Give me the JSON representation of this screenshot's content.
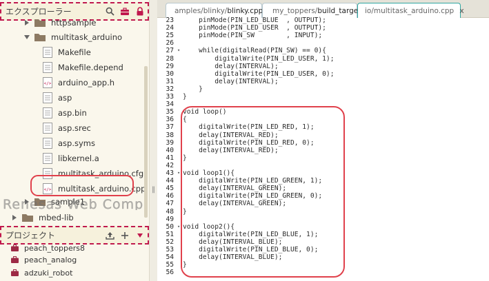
{
  "explorer": {
    "title": "エクスプローラー",
    "icons": [
      "search-icon",
      "briefcase-icon",
      "lock-icon"
    ],
    "tree": [
      {
        "label": "httpsample",
        "kind": "folder",
        "expanded": false
      },
      {
        "label": "multitask_arduino",
        "kind": "folder",
        "expanded": true
      },
      {
        "label": "Makefile",
        "kind": "file"
      },
      {
        "label": "Makefile.depend",
        "kind": "file"
      },
      {
        "label": "arduino_app.h",
        "kind": "code"
      },
      {
        "label": "asp",
        "kind": "file"
      },
      {
        "label": "asp.bin",
        "kind": "file"
      },
      {
        "label": "asp.srec",
        "kind": "file"
      },
      {
        "label": "asp.syms",
        "kind": "file"
      },
      {
        "label": "libkernel.a",
        "kind": "file"
      },
      {
        "label": "multitask_arduino.cfg",
        "kind": "file"
      },
      {
        "label": "multitask_arduino.cpp",
        "kind": "code"
      },
      {
        "label": "sample1",
        "kind": "folder",
        "expanded": false
      },
      {
        "label": "mbed-lib",
        "kind": "folder",
        "expanded": false
      }
    ],
    "watermark": "Renesas Web Compiler"
  },
  "project": {
    "title": "プロジェクト",
    "icons": [
      "upload-icon",
      "plus-icon",
      "caret-down-icon"
    ],
    "items": [
      "peach_toppers8",
      "peach_analog",
      "adzuki_robot"
    ]
  },
  "tabs": [
    {
      "prefix": "amples/blinky/",
      "strong": "blinky.cpp",
      "close": "x"
    },
    {
      "prefix": "my_toppers/",
      "strong": "build_target",
      "close": "x"
    },
    {
      "prefix": "io/multitask_arduino.cpp",
      "strong": "",
      "close": "x"
    }
  ],
  "code": [
    {
      "n": "23",
      "t": "    pinMode(PIN_LED_BLUE  , OUTPUT);"
    },
    {
      "n": "24",
      "t": "    pinMode(PIN_LED_USER  , OUTPUT);"
    },
    {
      "n": "25",
      "t": "    pinMode(PIN_SW        , INPUT);"
    },
    {
      "n": "26",
      "t": ""
    },
    {
      "n": "27",
      "t": "    while(digitalRead(PIN_SW) == 0){",
      "fold": true
    },
    {
      "n": "28",
      "t": "        digitalWrite(PIN_LED_USER, 1);"
    },
    {
      "n": "29",
      "t": "        delay(INTERVAL);"
    },
    {
      "n": "30",
      "t": "        digitalWrite(PIN_LED_USER, 0);"
    },
    {
      "n": "31",
      "t": "        delay(INTERVAL);"
    },
    {
      "n": "32",
      "t": "    }"
    },
    {
      "n": "33",
      "t": "}"
    },
    {
      "n": "34",
      "t": ""
    },
    {
      "n": "35",
      "t": "void loop()"
    },
    {
      "n": "36",
      "t": "{"
    },
    {
      "n": "37",
      "t": "    digitalWrite(PIN_LED_RED, 1);"
    },
    {
      "n": "38",
      "t": "    delay(INTERVAL_RED);"
    },
    {
      "n": "39",
      "t": "    digitalWrite(PIN_LED_RED, 0);"
    },
    {
      "n": "40",
      "t": "    delay(INTERVAL_RED);"
    },
    {
      "n": "41",
      "t": "}"
    },
    {
      "n": "42",
      "t": ""
    },
    {
      "n": "43",
      "t": "void loop1(){",
      "fold": true
    },
    {
      "n": "44",
      "t": "    digitalWrite(PIN_LED_GREEN, 1);"
    },
    {
      "n": "45",
      "t": "    delay(INTERVAL_GREEN);"
    },
    {
      "n": "46",
      "t": "    digitalWrite(PIN_LED_GREEN, 0);"
    },
    {
      "n": "47",
      "t": "    delay(INTERVAL_GREEN);"
    },
    {
      "n": "48",
      "t": "}"
    },
    {
      "n": "49",
      "t": ""
    },
    {
      "n": "50",
      "t": "void loop2(){",
      "fold": true
    },
    {
      "n": "51",
      "t": "    digitalWrite(PIN_LED_BLUE, 1);"
    },
    {
      "n": "52",
      "t": "    delay(INTERVAL_BLUE);"
    },
    {
      "n": "53",
      "t": "    digitalWrite(PIN_LED_BLUE, 0);"
    },
    {
      "n": "54",
      "t": "    delay(INTERVAL_BLUE);"
    },
    {
      "n": "55",
      "t": "}"
    },
    {
      "n": "56",
      "t": ""
    }
  ],
  "colors": {
    "annotation": "#e0404b",
    "header_border": "#c0184d",
    "active_tab": "#2ea6a1",
    "panel_bg": "#faf7ec"
  }
}
